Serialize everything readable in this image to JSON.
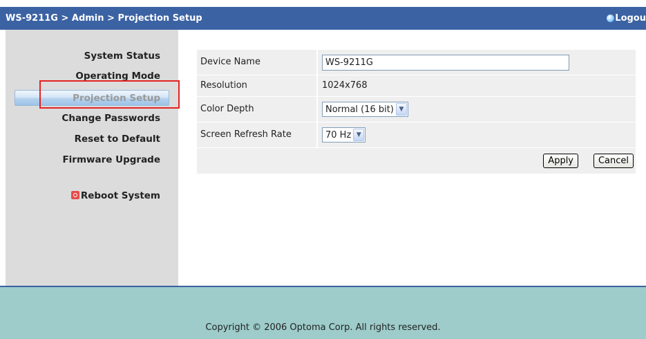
{
  "header": {
    "breadcrumb": "WS-9211G > Admin > Projection Setup",
    "logout_label": "Logou"
  },
  "sidebar": {
    "items": [
      {
        "label": "System Status"
      },
      {
        "label": "Operating Mode"
      },
      {
        "label": "Projection Setup",
        "active": true
      },
      {
        "label": "Change Passwords"
      },
      {
        "label": "Reset to Default"
      },
      {
        "label": "Firmware Upgrade"
      }
    ],
    "reboot_label": "Reboot System"
  },
  "form": {
    "device_name": {
      "label": "Device Name",
      "value": "WS-9211G"
    },
    "resolution": {
      "label": "Resolution",
      "value": "1024x768"
    },
    "color_depth": {
      "label": "Color Depth",
      "selected": "Normal (16 bit)"
    },
    "refresh_rate": {
      "label": "Screen Refresh Rate",
      "selected": "70 Hz"
    },
    "apply_label": "Apply",
    "cancel_label": "Cancel"
  },
  "footer": {
    "copyright": "Copyright © 2006 Optoma Corp. All rights reserved."
  },
  "colors": {
    "header": "#3b62a3",
    "sidebar": "#dcdcdc",
    "footer": "#9dccca",
    "highlight": "#e52222"
  },
  "icons": {
    "logout": "logout-globe-icon",
    "reboot": "power-icon",
    "select_arrow": "chevron-down-icon"
  }
}
